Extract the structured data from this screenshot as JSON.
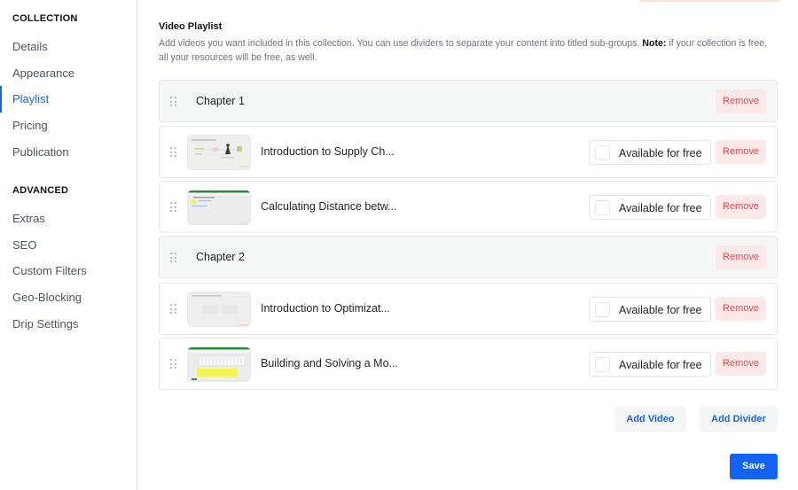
{
  "sidebar": {
    "sections": [
      {
        "title": "COLLECTION",
        "items": [
          {
            "label": "Details",
            "active": false
          },
          {
            "label": "Appearance",
            "active": false
          },
          {
            "label": "Playlist",
            "active": true
          },
          {
            "label": "Pricing",
            "active": false
          },
          {
            "label": "Publication",
            "active": false
          }
        ]
      },
      {
        "title": "ADVANCED",
        "items": [
          {
            "label": "Extras",
            "active": false
          },
          {
            "label": "SEO",
            "active": false
          },
          {
            "label": "Custom Filters",
            "active": false
          },
          {
            "label": "Geo-Blocking",
            "active": false
          },
          {
            "label": "Drip Settings",
            "active": false
          }
        ]
      }
    ]
  },
  "playlist": {
    "title": "Video Playlist",
    "description": "Add videos you want included in this collection. You can use dividers to separate your content into titled sub-groups.",
    "note_label": "Note:",
    "note_text": "if your collection is free, all your resources will be free, as well.",
    "items": [
      {
        "type": "divider",
        "label": "Chapter 1",
        "remove_label": "Remove"
      },
      {
        "type": "video",
        "title": "Introduction to Supply Ch...",
        "thumbnail": "diagram-slide",
        "free_label": "Available for free",
        "free_checked": false,
        "remove_label": "Remove"
      },
      {
        "type": "video",
        "title": "Calculating Distance betw...",
        "thumbnail": "spreadsheet-green-header",
        "free_label": "Available for free",
        "free_checked": false,
        "remove_label": "Remove"
      },
      {
        "type": "divider",
        "label": "Chapter 2",
        "remove_label": "Remove"
      },
      {
        "type": "video",
        "title": "Introduction to Optimizat...",
        "thumbnail": "blank-slide",
        "free_label": "Available for free",
        "free_checked": false,
        "remove_label": "Remove"
      },
      {
        "type": "video",
        "title": "Building and Solving a Mo...",
        "thumbnail": "spreadsheet-yellow-highlight",
        "free_label": "Available for free",
        "free_checked": false,
        "remove_label": "Remove"
      }
    ],
    "add_video_label": "Add Video",
    "add_divider_label": "Add Divider",
    "save_label": "Save"
  },
  "colors": {
    "accent": "#1763e8",
    "save": "#1262f3",
    "remove_text": "#e5484d",
    "remove_bg": "#fde8e8",
    "divider_bg": "#f5f6f6"
  }
}
